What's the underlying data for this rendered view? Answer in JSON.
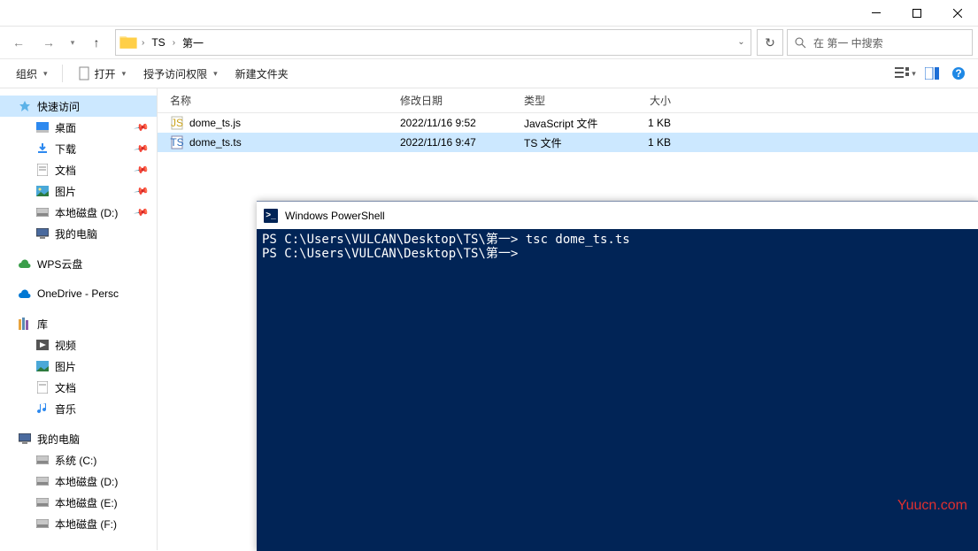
{
  "window_controls": {
    "min": "—",
    "max": "☐",
    "close": "✕"
  },
  "nav": {
    "back": "←",
    "fwd": "→",
    "up": "↑"
  },
  "breadcrumb": {
    "parts": [
      "TS",
      "第一"
    ]
  },
  "refresh": "↻",
  "search": {
    "placeholder": "在 第一 中搜索"
  },
  "toolbar": {
    "organize": "组织",
    "open": "打开",
    "access": "授予访问权限",
    "newfolder": "新建文件夹"
  },
  "columns": {
    "name": "名称",
    "date": "修改日期",
    "type": "类型",
    "size": "大小"
  },
  "files": [
    {
      "name": "dome_ts.js",
      "date": "2022/11/16 9:52",
      "type": "JavaScript 文件",
      "size": "1 KB",
      "selected": false,
      "icon": "js"
    },
    {
      "name": "dome_ts.ts",
      "date": "2022/11/16 9:47",
      "type": "TS 文件",
      "size": "1 KB",
      "selected": true,
      "icon": "ts"
    }
  ],
  "sidebar": {
    "quick": "快速访问",
    "desktop": "桌面",
    "downloads": "下载",
    "documents": "文档",
    "pictures": "图片",
    "localD": "本地磁盘 (D:)",
    "mypc": "我的电脑",
    "wps": "WPS云盘",
    "onedrive": "OneDrive - Persc",
    "library": "库",
    "video": "视频",
    "lib_pictures": "图片",
    "lib_docs": "文档",
    "music": "音乐",
    "mypc2": "我的电脑",
    "sysc": "系统 (C:)",
    "locald2": "本地磁盘 (D:)",
    "locale": "本地磁盘 (E:)",
    "localf": "本地磁盘 (F:)"
  },
  "powershell": {
    "title": "Windows PowerShell",
    "line1_prompt": "PS C:\\Users\\VULCAN\\Desktop\\TS\\第一> ",
    "line1_cmd": "tsc dome_ts.ts",
    "line2_prompt": "PS C:\\Users\\VULCAN\\Desktop\\TS\\第一>"
  },
  "watermark": "Yuucn.com"
}
